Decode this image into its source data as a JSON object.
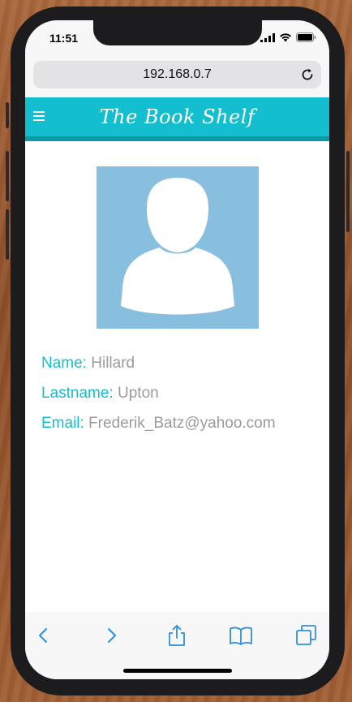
{
  "status_bar": {
    "time": "11:51",
    "icons": [
      "cellular-signal-icon",
      "wifi-icon",
      "battery-icon"
    ]
  },
  "browser": {
    "url": "192.168.0.7",
    "reload_icon": "reload-icon",
    "toolbar": [
      "back-icon",
      "forward-icon",
      "share-icon",
      "bookmarks-icon",
      "tabs-icon"
    ]
  },
  "app": {
    "title": "The Book Shelf",
    "menu_icon": "hamburger-menu-icon"
  },
  "profile": {
    "avatar_icon": "user-avatar-icon",
    "name_label": "Name:",
    "name_value": "Hillard",
    "lastname_label": "Lastname:",
    "lastname_value": "Upton",
    "email_label": "Email:",
    "email_value": "Frederik_Batz@yahoo.com"
  },
  "colors": {
    "accent": "#13bfcf",
    "accent_dark": "#0a9aa8",
    "avatar_bg": "#88bfdf",
    "value_text": "#9b9b9b",
    "ios_blue": "#2f8fd8"
  }
}
